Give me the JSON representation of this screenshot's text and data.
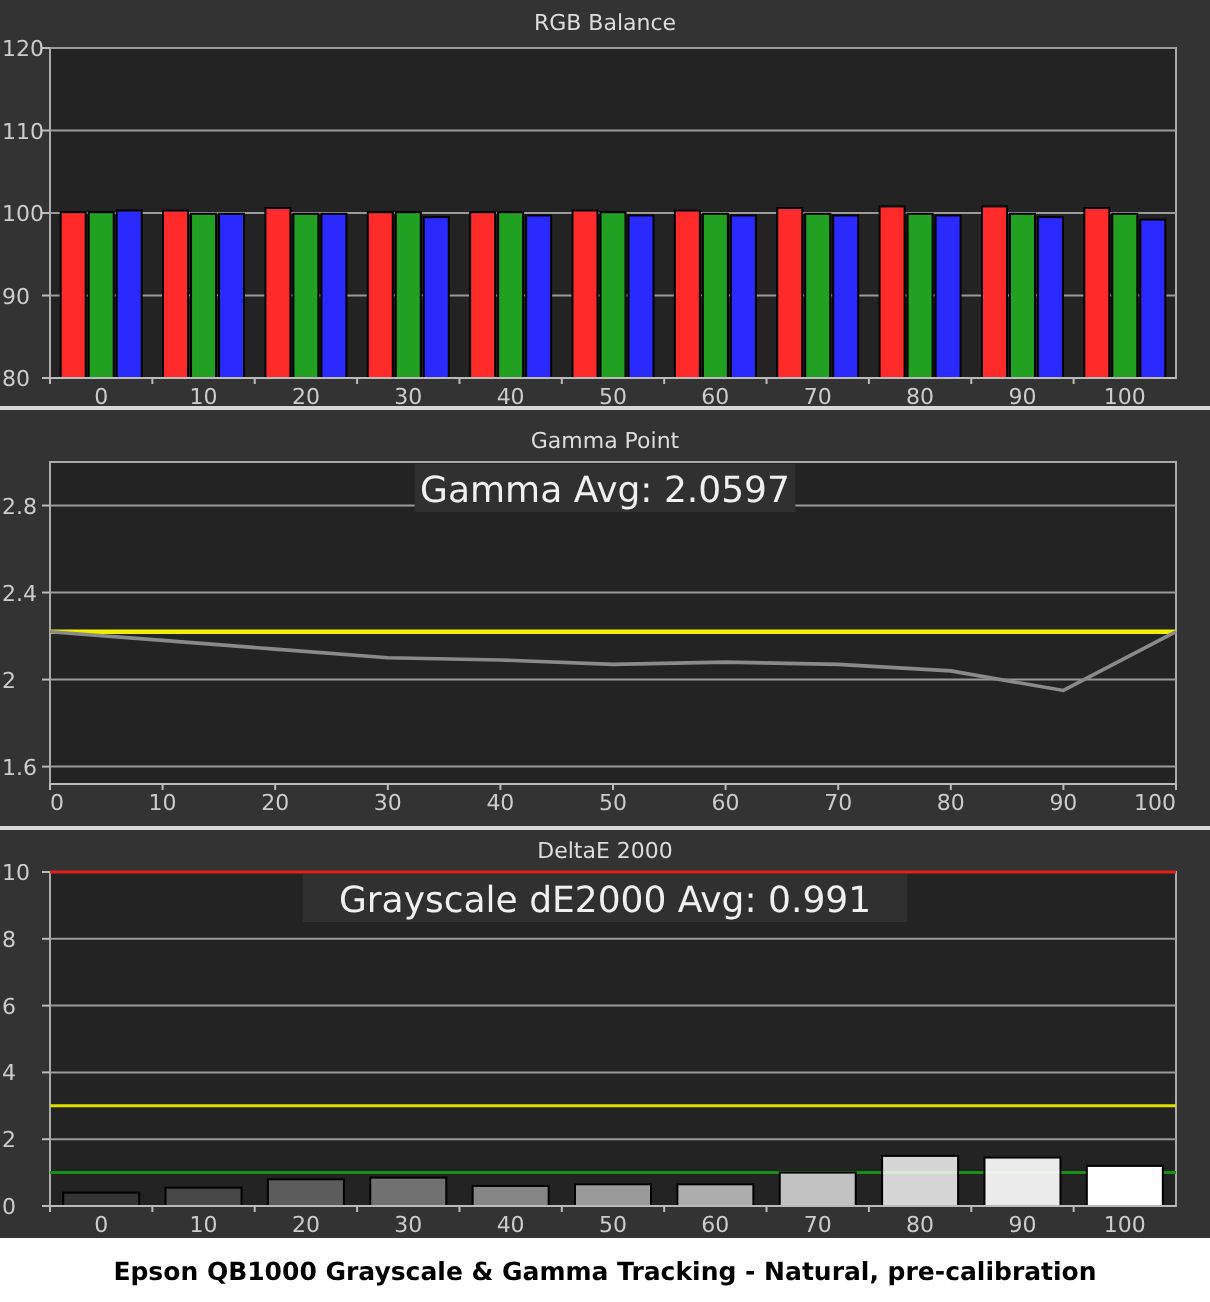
{
  "charts": [
    {
      "title": "RGB Balance",
      "chart_data": {
        "type": "bar",
        "categories": [
          "0",
          "10",
          "20",
          "30",
          "40",
          "50",
          "60",
          "70",
          "80",
          "90",
          "100"
        ],
        "series": [
          {
            "color": "#ff2a2a",
            "values": [
              100.1,
              100.3,
              100.6,
              100.1,
              100.1,
              100.3,
              100.3,
              100.6,
              100.8,
              100.8,
              100.6
            ]
          },
          {
            "color": "#22a022",
            "values": [
              100.1,
              99.9,
              99.9,
              100.1,
              100.1,
              100.1,
              99.9,
              99.9,
              99.9,
              99.9,
              99.9
            ]
          },
          {
            "color": "#2a2aff",
            "values": [
              100.3,
              99.9,
              99.9,
              99.5,
              99.7,
              99.7,
              99.7,
              99.7,
              99.7,
              99.5,
              99.2
            ]
          }
        ],
        "ylim": [
          80,
          120
        ],
        "yticks": [
          80,
          90,
          100,
          110,
          120
        ],
        "grid": true
      }
    },
    {
      "title": "Gamma Point",
      "average_label": "Gamma Avg: 2.0597",
      "chart_data": {
        "type": "line",
        "x": [
          0,
          10,
          20,
          30,
          40,
          50,
          60,
          70,
          80,
          90,
          100
        ],
        "series": [
          {
            "color": "#8a8a8a",
            "values": [
              2.22,
              2.18,
              2.14,
              2.1,
              2.09,
              2.07,
              2.08,
              2.07,
              2.04,
              1.95,
              2.22
            ]
          },
          {
            "color": "#f0f000",
            "values": [
              2.22,
              2.22,
              2.22,
              2.22,
              2.22,
              2.22,
              2.22,
              2.22,
              2.22,
              2.22,
              2.22
            ]
          }
        ],
        "xlim": [
          0,
          100
        ],
        "ylim": [
          1.52,
          3.0
        ],
        "xticks": [
          0,
          10,
          20,
          30,
          40,
          50,
          60,
          70,
          80,
          90,
          100
        ],
        "yticks": [
          1.6,
          2,
          2.4,
          2.8
        ],
        "grid": true
      }
    },
    {
      "title": "DeltaE 2000",
      "average_label": "Grayscale dE2000 Avg: 0.991",
      "chart_data": {
        "type": "bar",
        "categories": [
          "0",
          "10",
          "20",
          "30",
          "40",
          "50",
          "60",
          "70",
          "80",
          "90",
          "100"
        ],
        "series": [
          {
            "color": "#ffffff",
            "values": [
              0.4,
              0.55,
              0.8,
              0.85,
              0.6,
              0.65,
              0.65,
              1.0,
              1.5,
              1.45,
              1.2
            ]
          }
        ],
        "ylim": [
          0,
          10
        ],
        "yticks": [
          0,
          2,
          4,
          6,
          8,
          10
        ],
        "grid": true,
        "ref_lines": [
          {
            "axis": "y",
            "value": 10,
            "color": "#e02020"
          },
          {
            "axis": "y",
            "value": 3,
            "color": "#e0e000"
          },
          {
            "axis": "y",
            "value": 1,
            "color": "#189018"
          }
        ]
      }
    }
  ],
  "caption": "Epson QB1000 Grayscale & Gamma Tracking - Natural, pre-calibration"
}
